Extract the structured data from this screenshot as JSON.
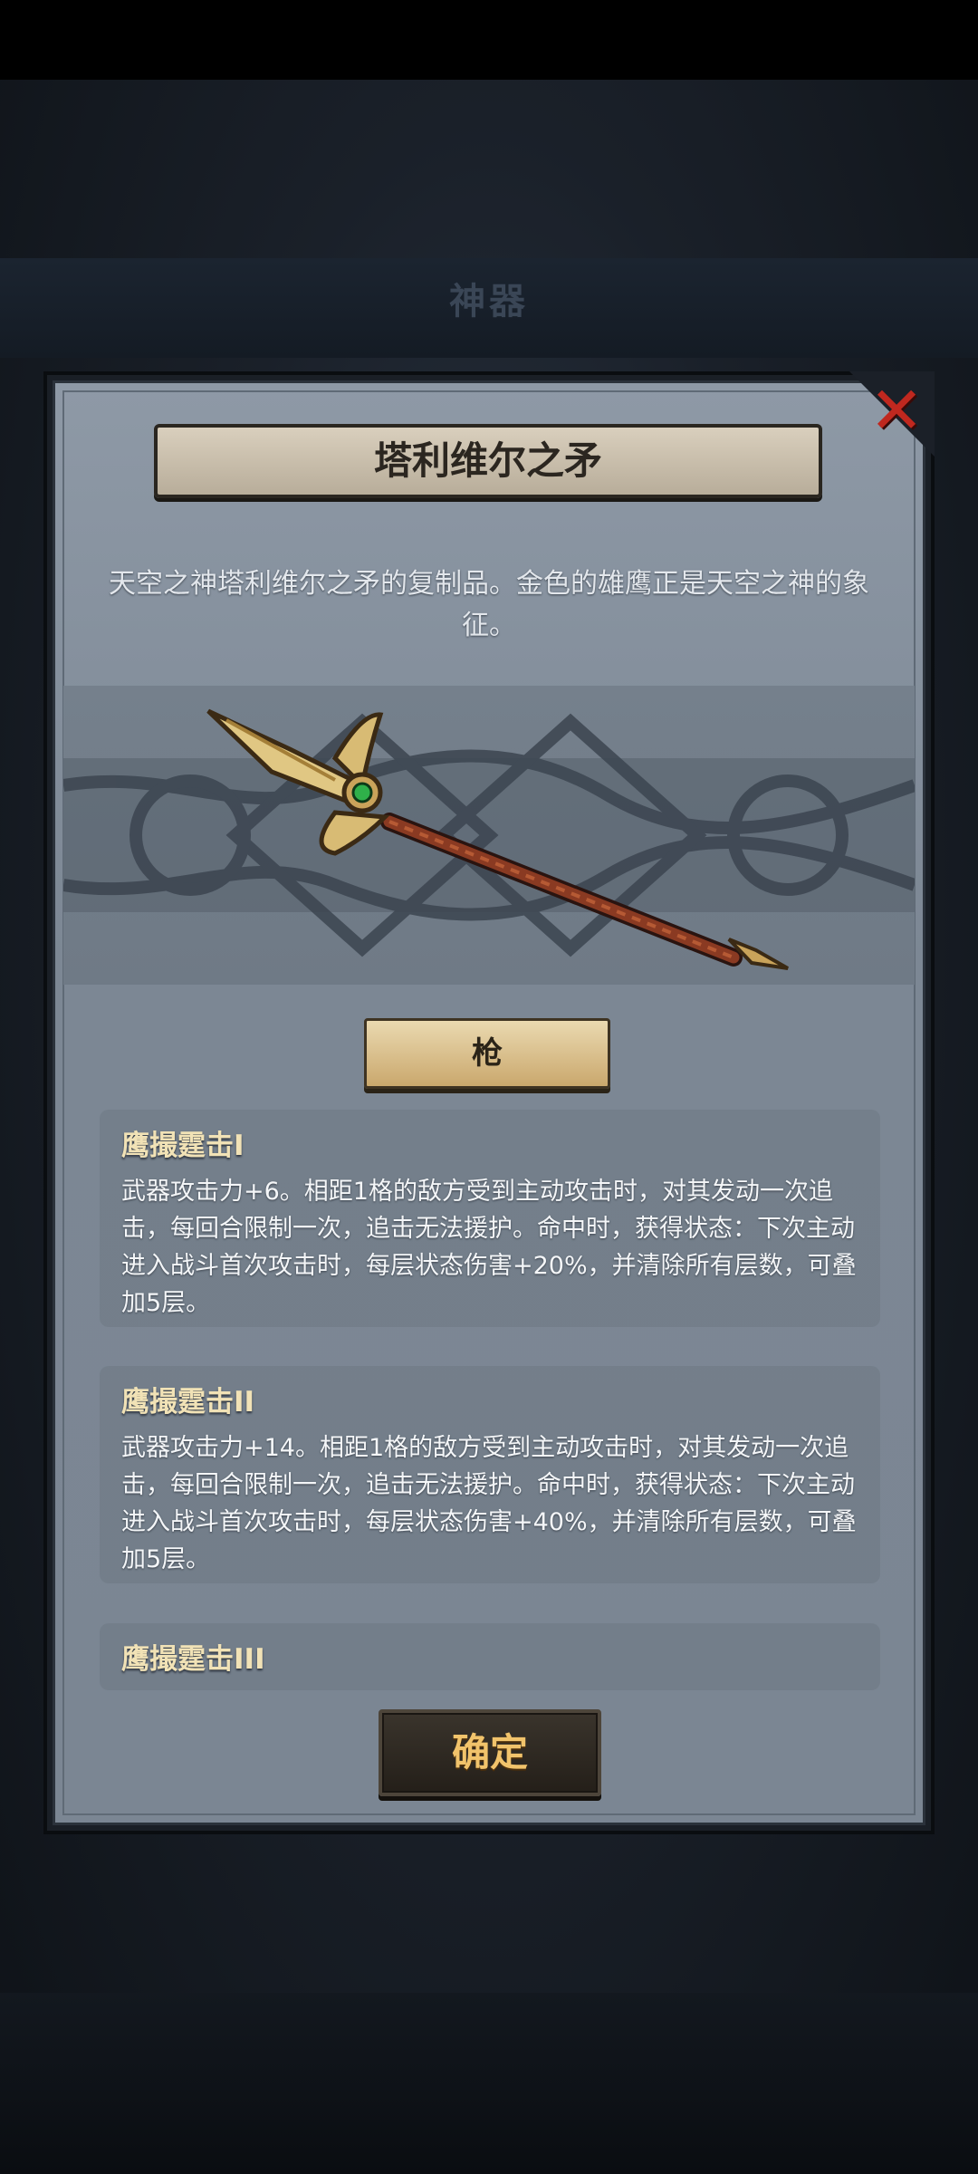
{
  "background": {
    "dim_title": "神器"
  },
  "dialog": {
    "title": "塔利维尔之矛",
    "description": "天空之神塔利维尔之矛的复制品。金色的雄鹰正是天空之神的象征。",
    "weapon_type": "枪",
    "weapon_image": "golden-spear-icon",
    "close_icon": "close-icon",
    "skills": [
      {
        "name": "鹰撮霆击I",
        "text": "武器攻击力+6。相距1格的敌方受到主动攻击时，对其发动一次追击，每回合限制一次，追击无法援护。命中时，获得状态：下次主动进入战斗首次攻击时，每层状态伤害+20%，并清除所有层数，可叠加5层。"
      },
      {
        "name": "鹰撮霆击II",
        "text": "武器攻击力+14。相距1格的敌方受到主动攻击时，对其发动一次追击，每回合限制一次，追击无法援护。命中时，获得状态：下次主动进入战斗首次攻击时，每层状态伤害+40%，并清除所有层数，可叠加5层。"
      },
      {
        "name": "鹰撮霆击III",
        "text": ""
      }
    ],
    "confirm_label": "确定"
  },
  "colors": {
    "title_plate": "#c9bfac",
    "type_button": "#d9bf86",
    "confirm_text": "#f1c36b",
    "close_x": "#c0281f",
    "skill_title": "#f1e2b6"
  }
}
